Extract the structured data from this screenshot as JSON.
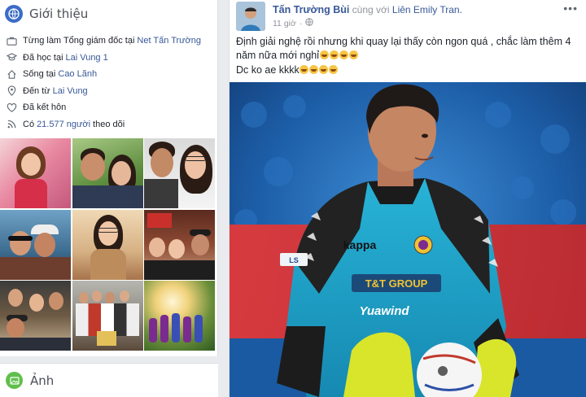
{
  "intro": {
    "title": "Giới thiệu",
    "items": [
      {
        "icon": "briefcase-icon",
        "prefix": "Từng làm Tổng giám đốc tại",
        "link": "Net Tấn Trường",
        "suffix": ""
      },
      {
        "icon": "graduation-cap-icon",
        "prefix": "Đã học tại",
        "link": "Lai Vung 1",
        "suffix": ""
      },
      {
        "icon": "home-icon",
        "prefix": "Sống tại",
        "link": "Cao Lãnh",
        "suffix": ""
      },
      {
        "icon": "location-pin-icon",
        "prefix": "Đến từ",
        "link": "Lai Vung",
        "suffix": ""
      },
      {
        "icon": "heart-icon",
        "prefix": "Đã kết hôn",
        "link": "",
        "suffix": ""
      },
      {
        "icon": "rss-feed-icon",
        "prefix": "Có",
        "link": "21.577 người",
        "suffix": "theo dõi"
      }
    ]
  },
  "photos_section": {
    "title": "Ảnh"
  },
  "post": {
    "author": "Tấn Trường Bùi",
    "with_text": "cùng với",
    "with_name": "Liên Emily Tran.",
    "time": "11 giờ",
    "more": "•••",
    "line1": "Định giải nghệ rồi nhưng khi quay lại thấy còn ngon quá , chắc làm thêm 4 năm nữa mới nghỉ",
    "line2": "Dc ko ae kkkk"
  },
  "jersey": {
    "brand": "T&T GROUP",
    "sponsor": "Yuawind"
  },
  "colors": {
    "link": "#385898",
    "text": "#1d2129",
    "meta": "#90949c",
    "background": "#e9ebee"
  }
}
